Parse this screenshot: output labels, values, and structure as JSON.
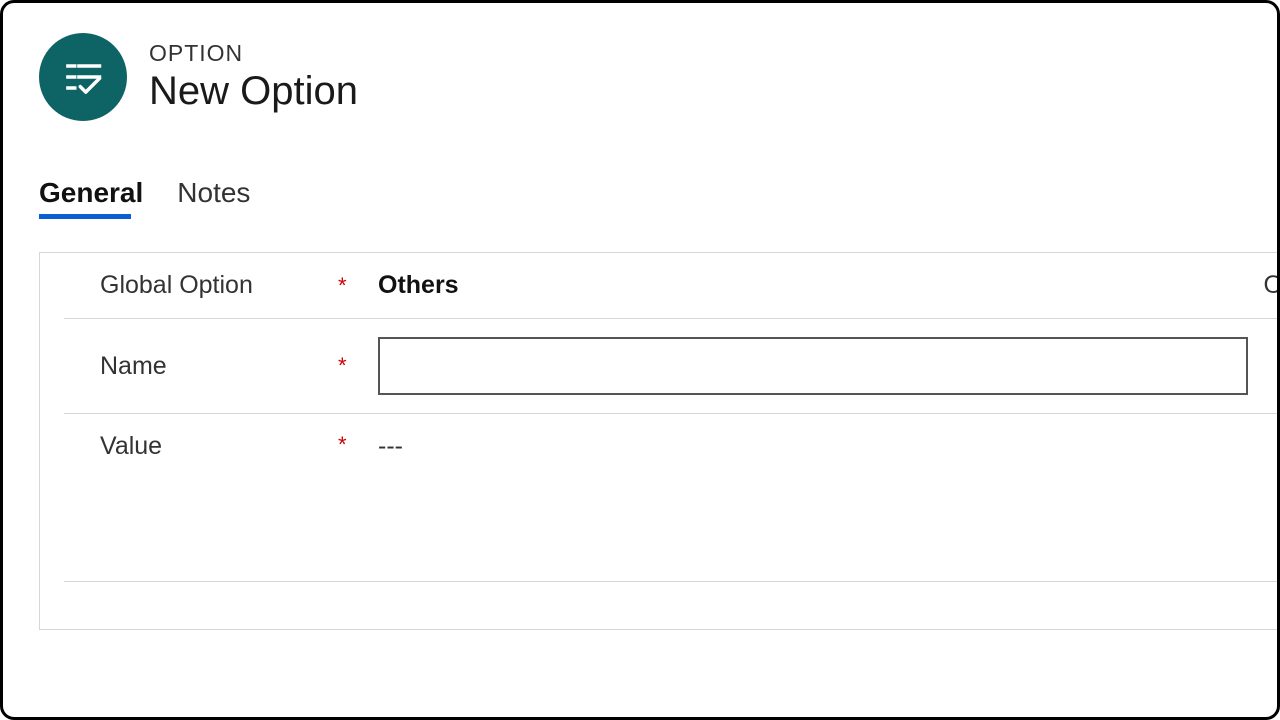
{
  "header": {
    "supertitle": "OPTION",
    "title": "New Option"
  },
  "tabs": [
    {
      "label": "General",
      "active": true
    },
    {
      "label": "Notes",
      "active": false
    }
  ],
  "form": {
    "global_option": {
      "label": "Global Option",
      "required_marker": "*",
      "value": "Others",
      "clear_glyph": "O"
    },
    "name": {
      "label": "Name",
      "required_marker": "*",
      "value": ""
    },
    "value_field": {
      "label": "Value",
      "required_marker": "*",
      "value": "---"
    }
  }
}
